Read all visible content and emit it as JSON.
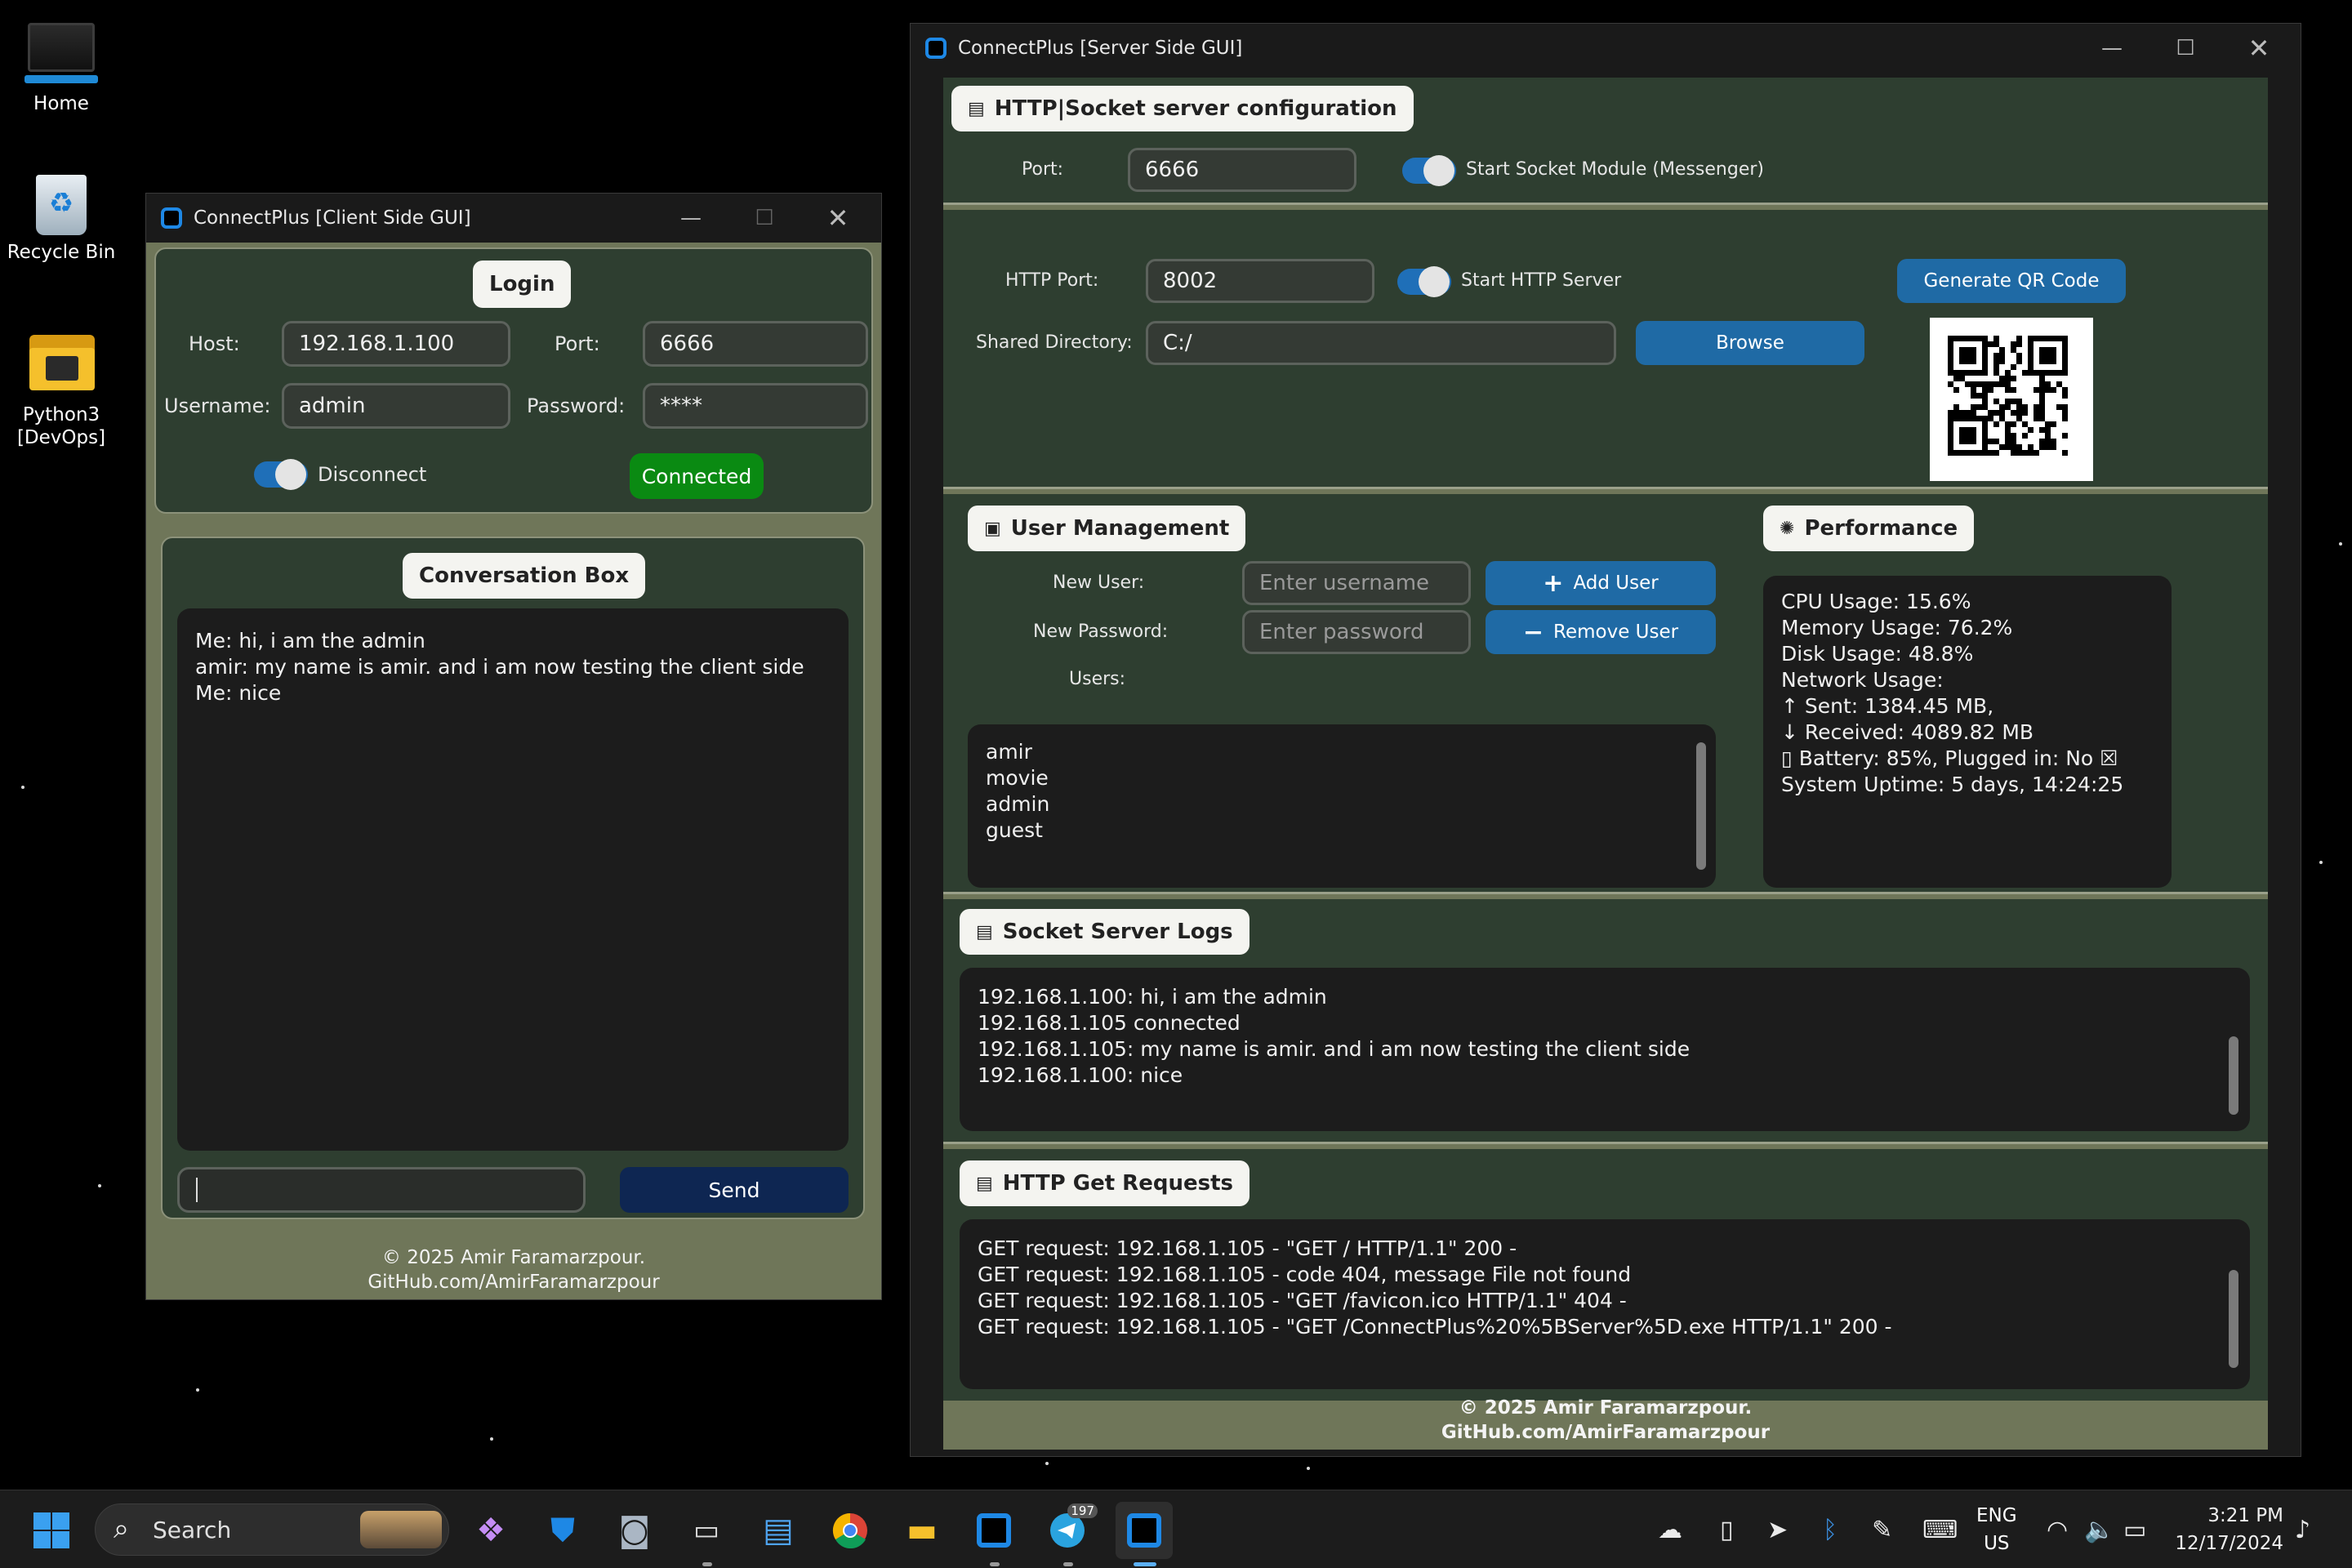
{
  "desktop": {
    "icons": [
      {
        "label": "Home",
        "icon": "monitor-icon"
      },
      {
        "label": "Recycle Bin",
        "icon": "recycle-bin-icon"
      },
      {
        "label": "Python3 [DevOps]",
        "icon": "folder-icon"
      }
    ]
  },
  "client": {
    "title": "ConnectPlus [Client Side GUI]",
    "login": {
      "heading": "Login",
      "host_label": "Host:",
      "host_value": "192.168.1.100",
      "port_label": "Port:",
      "port_value": "6666",
      "username_label": "Username:",
      "username_value": "admin",
      "password_label": "Password:",
      "password_value": "****",
      "toggle_label": "Disconnect",
      "status": "Connected"
    },
    "conversation": {
      "heading": "Conversation Box",
      "messages": [
        "Me: hi, i am the admin",
        "amir: my name is amir. and i am now testing the client side",
        "Me: nice"
      ],
      "input_value": "",
      "send_label": "Send"
    },
    "footer": [
      "© 2025 Amir Faramarzpour.",
      "GitHub.com/AmirFaramarzpour"
    ]
  },
  "server": {
    "title": "ConnectPlus [Server Side GUI]",
    "config": {
      "heading": "HTTP|Socket server configuration",
      "port_label": "Port:",
      "port_value": "6666",
      "socket_toggle_label": "Start Socket Module (Messenger)",
      "http_port_label": "HTTP Port:",
      "http_port_value": "8002",
      "http_toggle_label": "Start HTTP Server",
      "qr_button": "Generate QR Code",
      "shared_dir_label": "Shared Directory:",
      "shared_dir_value": "C:/",
      "browse_button": "Browse"
    },
    "users": {
      "heading": "User Management",
      "new_user_label": "New User:",
      "new_user_placeholder": "Enter username",
      "new_password_label": "New Password:",
      "new_password_placeholder": "Enter password",
      "add_button": "Add User",
      "remove_button": "Remove User",
      "users_label": "Users:",
      "list": [
        "amir",
        "movie",
        "admin",
        "guest"
      ]
    },
    "performance": {
      "heading": "Performance",
      "lines": [
        "CPU Usage: 15.6%",
        "Memory Usage: 76.2%",
        "Disk Usage: 48.8%",
        "Network Usage:",
        "↑ Sent: 1384.45 MB,",
        "↓ Received: 4089.82 MB",
        "▯ Battery: 85%, Plugged in: No ☒",
        "System Uptime: 5 days, 14:24:25"
      ]
    },
    "socket_logs": {
      "heading": "Socket Server Logs",
      "lines": [
        "192.168.1.100: hi, i am the admin",
        "192.168.1.105 connected",
        "192.168.1.105: my name is amir. and i am now testing the client side",
        "192.168.1.100: nice"
      ]
    },
    "http_logs": {
      "heading": "HTTP Get Requests",
      "lines": [
        "GET request: 192.168.1.105 - \"GET / HTTP/1.1\" 200 -",
        "GET request: 192.168.1.105 - code 404, message File not found",
        "GET request: 192.168.1.105 - \"GET /favicon.ico HTTP/1.1\" 404 -",
        "GET request: 192.168.1.105 - \"GET /ConnectPlus%20%5BServer%5D.exe HTTP/1.1\" 200 -"
      ]
    },
    "footer": [
      "© 2025 Amir Faramarzpour.",
      "GitHub.com/AmirFaramarzpour"
    ]
  },
  "taskbar": {
    "search_label": "Search",
    "telegram_badge": "197",
    "lang": [
      "ENG",
      "US"
    ],
    "time": "3:21 PM",
    "date": "12/17/2024"
  },
  "colors": {
    "panel_green": "#2e3e30",
    "window_olive": "#6f7659",
    "accent_blue": "#1f6aa5",
    "connected_green": "#0a8a12",
    "send_navy": "#0e2652"
  }
}
